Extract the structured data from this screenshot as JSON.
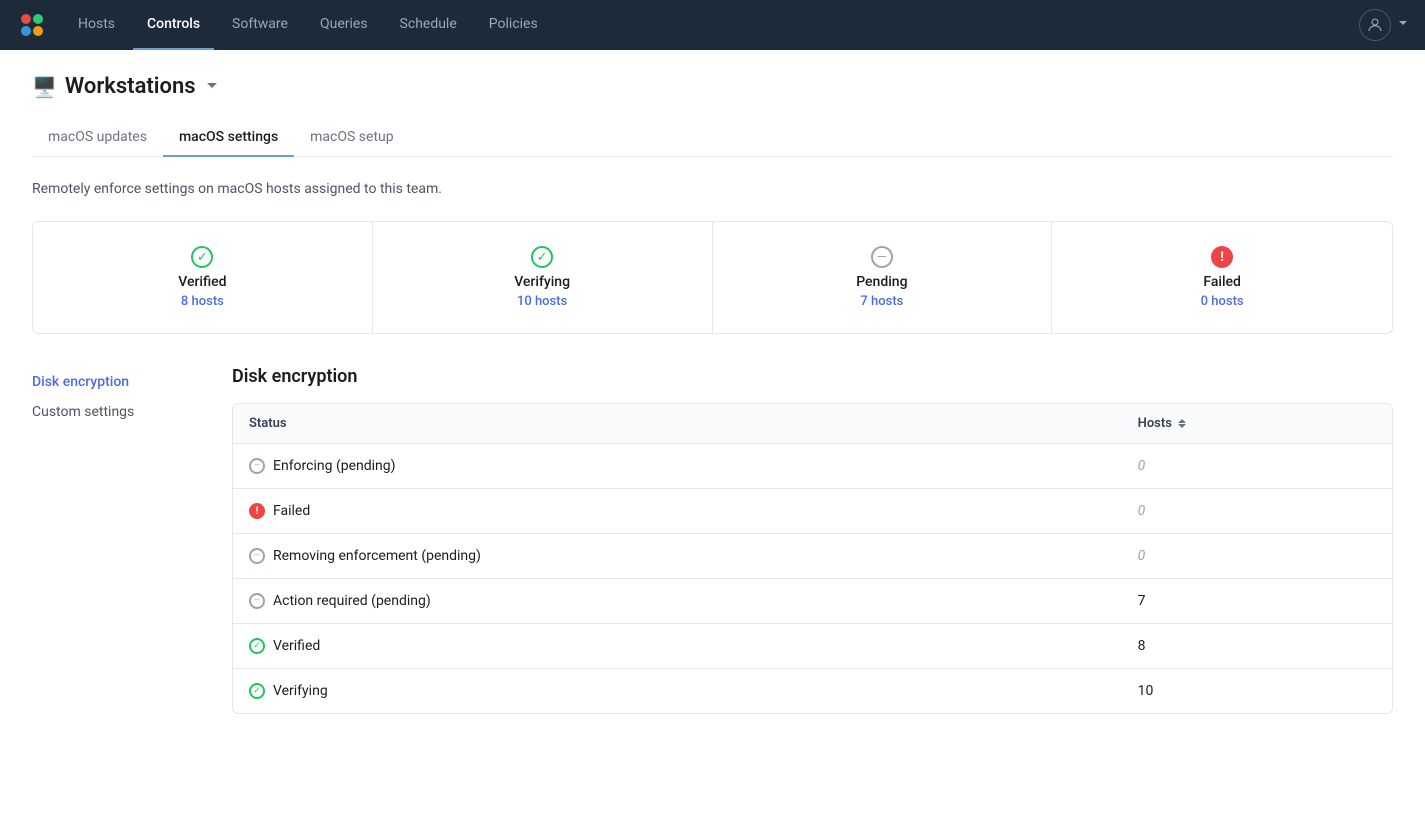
{
  "nav": {
    "items": [
      {
        "label": "Hosts",
        "active": false
      },
      {
        "label": "Controls",
        "active": true
      },
      {
        "label": "Software",
        "active": false
      },
      {
        "label": "Queries",
        "active": false
      },
      {
        "label": "Schedule",
        "active": false
      },
      {
        "label": "Policies",
        "active": false
      }
    ]
  },
  "page": {
    "title": "Workstations",
    "description": "Remotely enforce settings on macOS hosts assigned to this team."
  },
  "tabs": [
    {
      "label": "macOS updates",
      "active": false
    },
    {
      "label": "macOS settings",
      "active": true
    },
    {
      "label": "macOS setup",
      "active": false
    }
  ],
  "status_cards": [
    {
      "label": "Verified",
      "count": "8 hosts",
      "status": "verified"
    },
    {
      "label": "Verifying",
      "count": "10 hosts",
      "status": "verifying"
    },
    {
      "label": "Pending",
      "count": "7 hosts",
      "status": "pending"
    },
    {
      "label": "Failed",
      "count": "0 hosts",
      "status": "failed"
    }
  ],
  "sidebar": {
    "items": [
      {
        "label": "Disk encryption",
        "active": true
      },
      {
        "label": "Custom settings",
        "active": false
      }
    ]
  },
  "content": {
    "title": "Disk encryption",
    "table": {
      "columns": [
        "Status",
        "Hosts"
      ],
      "rows": [
        {
          "status": "Enforcing (pending)",
          "type": "pending",
          "hosts": "0",
          "zero": true
        },
        {
          "status": "Failed",
          "type": "failed",
          "hosts": "0",
          "zero": true
        },
        {
          "status": "Removing enforcement (pending)",
          "type": "pending",
          "hosts": "0",
          "zero": true
        },
        {
          "status": "Action required (pending)",
          "type": "pending",
          "hosts": "7",
          "zero": false
        },
        {
          "status": "Verified",
          "type": "verified",
          "hosts": "8",
          "zero": false
        },
        {
          "status": "Verifying",
          "type": "verifying",
          "hosts": "10",
          "zero": false
        }
      ]
    }
  }
}
